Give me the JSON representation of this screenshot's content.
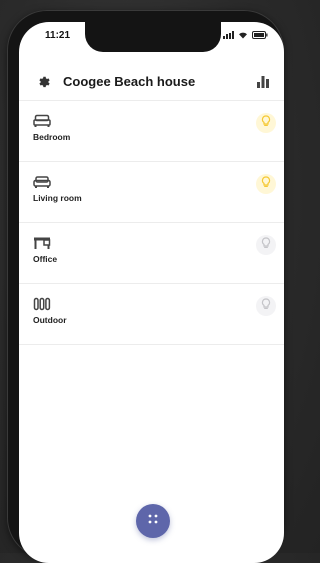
{
  "status_bar": {
    "time": "11:21"
  },
  "header": {
    "title": "Coogee Beach house"
  },
  "rooms": [
    {
      "label": "Bedroom",
      "icon": "bed-icon",
      "light": "on"
    },
    {
      "label": "Living room",
      "icon": "sofa-icon",
      "light": "on"
    },
    {
      "label": "Office",
      "icon": "desk-icon",
      "light": "off"
    },
    {
      "label": "Outdoor",
      "icon": "heater-icon",
      "light": "off"
    }
  ],
  "colors": {
    "accent": "#5e66aa",
    "light_on": "#f5c833",
    "light_on_bg": "#fff7d6",
    "light_off": "#c4c4c8"
  },
  "fab": {
    "icon": "grid-dots-icon"
  }
}
